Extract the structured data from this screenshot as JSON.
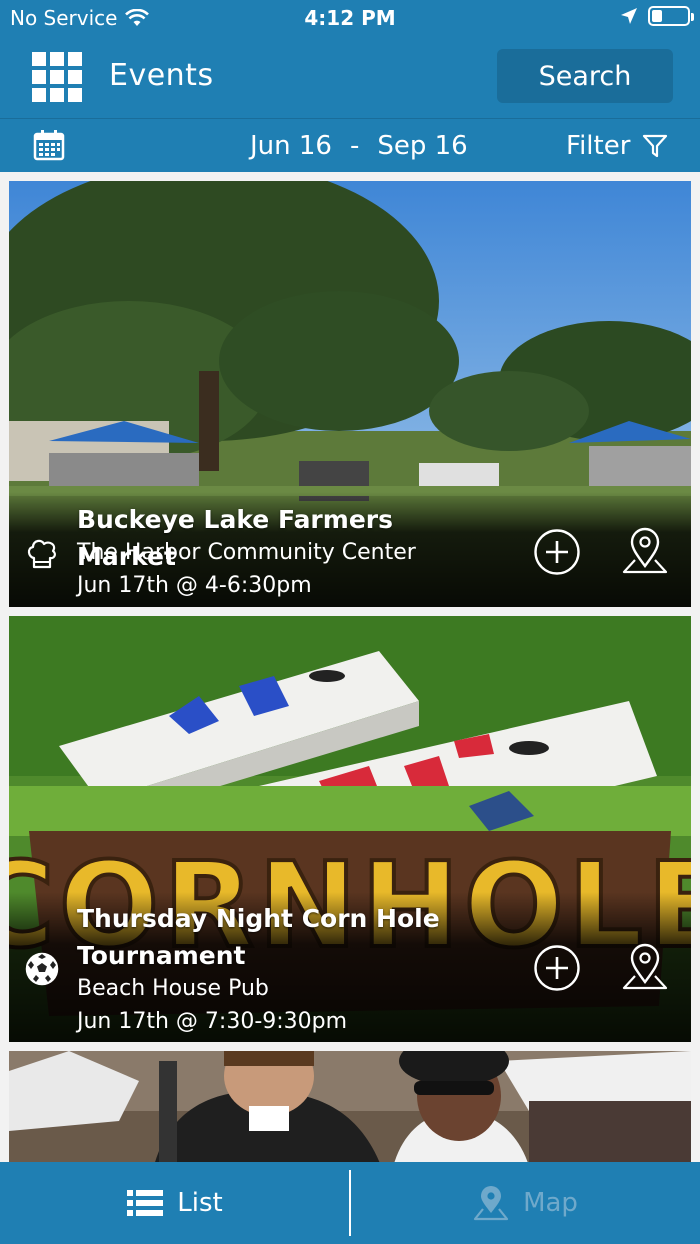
{
  "status_bar": {
    "carrier": "No Service",
    "time": "4:12 PM",
    "battery_level": 0.3
  },
  "header": {
    "title": "Events",
    "search_label": "Search"
  },
  "date_bar": {
    "start": "Jun 16",
    "separator": "-",
    "end": "Sep 16",
    "filter_label": "Filter"
  },
  "events": [
    {
      "title": "Buckeye Lake Farmers Market",
      "venue": "The Harbor Community Center",
      "date": "Jun 17th @ 4-6:30pm",
      "category_icon": "chef-hat-icon"
    },
    {
      "title": "Thursday Night Corn Hole Tournament",
      "venue": "Beach House Pub",
      "date": "Jun 17th @ 7:30-9:30pm",
      "category_icon": "soccer-ball-icon"
    }
  ],
  "tabs": {
    "list_label": "List",
    "map_label": "Map"
  },
  "colors": {
    "primary": "#1f7fb3",
    "button": "#1a6d9a",
    "inactive_tab": "#6fa9cb"
  }
}
